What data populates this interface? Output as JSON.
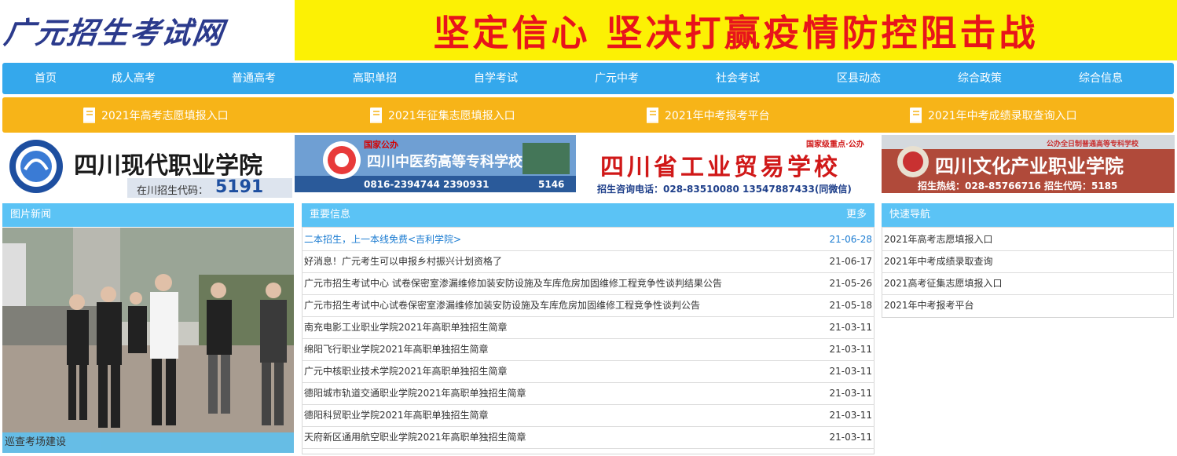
{
  "header": {
    "logo_text": "广元招生考试网",
    "banner_text": "坚定信心  坚决打赢疫情防控阻击战"
  },
  "nav": [
    "首页",
    "成人高考",
    "普通高考",
    "高职单招",
    "自学考试",
    "广元中考",
    "社会考试",
    "区县动态",
    "综合政策",
    "综合信息"
  ],
  "entries": [
    "2021年高考志愿填报入口",
    "2021年征集志愿填报入口",
    "2021年中考报考平台",
    "2021年中考成绩录取查询入口"
  ],
  "ads": [
    {
      "name": "四川现代职业学院",
      "sub": "在川招生代码：",
      "code": "5191",
      "bg": "#ffffff",
      "color": "#1a1a1a"
    },
    {
      "name": "四川中医药高等专科学校",
      "sub": "0816-2394744  2390931",
      "code": "5146",
      "tag": "国家公办",
      "bg": "#1e5aa8",
      "color": "#ffffff"
    },
    {
      "name": "四川省工业贸易学校",
      "sub": "招生咨询电话：028-83510080  13547887433(同微信)",
      "tag": "国家级重点·公办",
      "bg": "#ffffff",
      "color": "#d01818"
    },
    {
      "name": "四川文化产业职业学院",
      "sub": "招生热线：028-85766716  招生代码：5185",
      "tag": "公办全日制普通高等专科学校",
      "bg": "#c93131",
      "color": "#ffffff"
    }
  ],
  "photo_news": {
    "heading": "图片新闻",
    "caption": "巡查考场建设"
  },
  "important": {
    "heading": "重要信息",
    "more": "更多",
    "items": [
      {
        "title": "二本招生，上一本线免费<吉利学院>",
        "date": "21-06-28"
      },
      {
        "title": "好消息！广元考生可以申报乡村振兴计划资格了",
        "date": "21-06-17"
      },
      {
        "title": "广元市招生考试中心 试卷保密室渗漏维修加装安防设施及车库危房加固维修工程竞争性谈判结果公告",
        "date": "21-05-26"
      },
      {
        "title": "广元市招生考试中心试卷保密室渗漏维修加装安防设施及车库危房加固维修工程竞争性谈判公告",
        "date": "21-05-18"
      },
      {
        "title": "南充电影工业职业学院2021年高职单独招生简章",
        "date": "21-03-11"
      },
      {
        "title": "绵阳飞行职业学院2021年高职单独招生简章",
        "date": "21-03-11"
      },
      {
        "title": "广元中核职业技术学院2021年高职单独招生简章",
        "date": "21-03-11"
      },
      {
        "title": "德阳城市轨道交通职业学院2021年高职单独招生简章",
        "date": "21-03-11"
      },
      {
        "title": "德阳科贸职业学院2021年高职单独招生简章",
        "date": "21-03-11"
      },
      {
        "title": "天府新区通用航空职业学院2021年高职单独招生简章",
        "date": "21-03-11"
      }
    ]
  },
  "quick_nav": {
    "heading": "快速导航",
    "items": [
      "2021年高考志愿填报入口",
      "2021年中考成绩录取查询",
      "2021高考征集志愿填报入口",
      "2021年中考报考平台"
    ]
  },
  "colors": {
    "nav_bg": "#34a8ec",
    "entries_bg": "#f7b418",
    "panel_head": "#5bc3f5",
    "banner_bg": "#fcf104",
    "banner_text": "#e8141b"
  }
}
